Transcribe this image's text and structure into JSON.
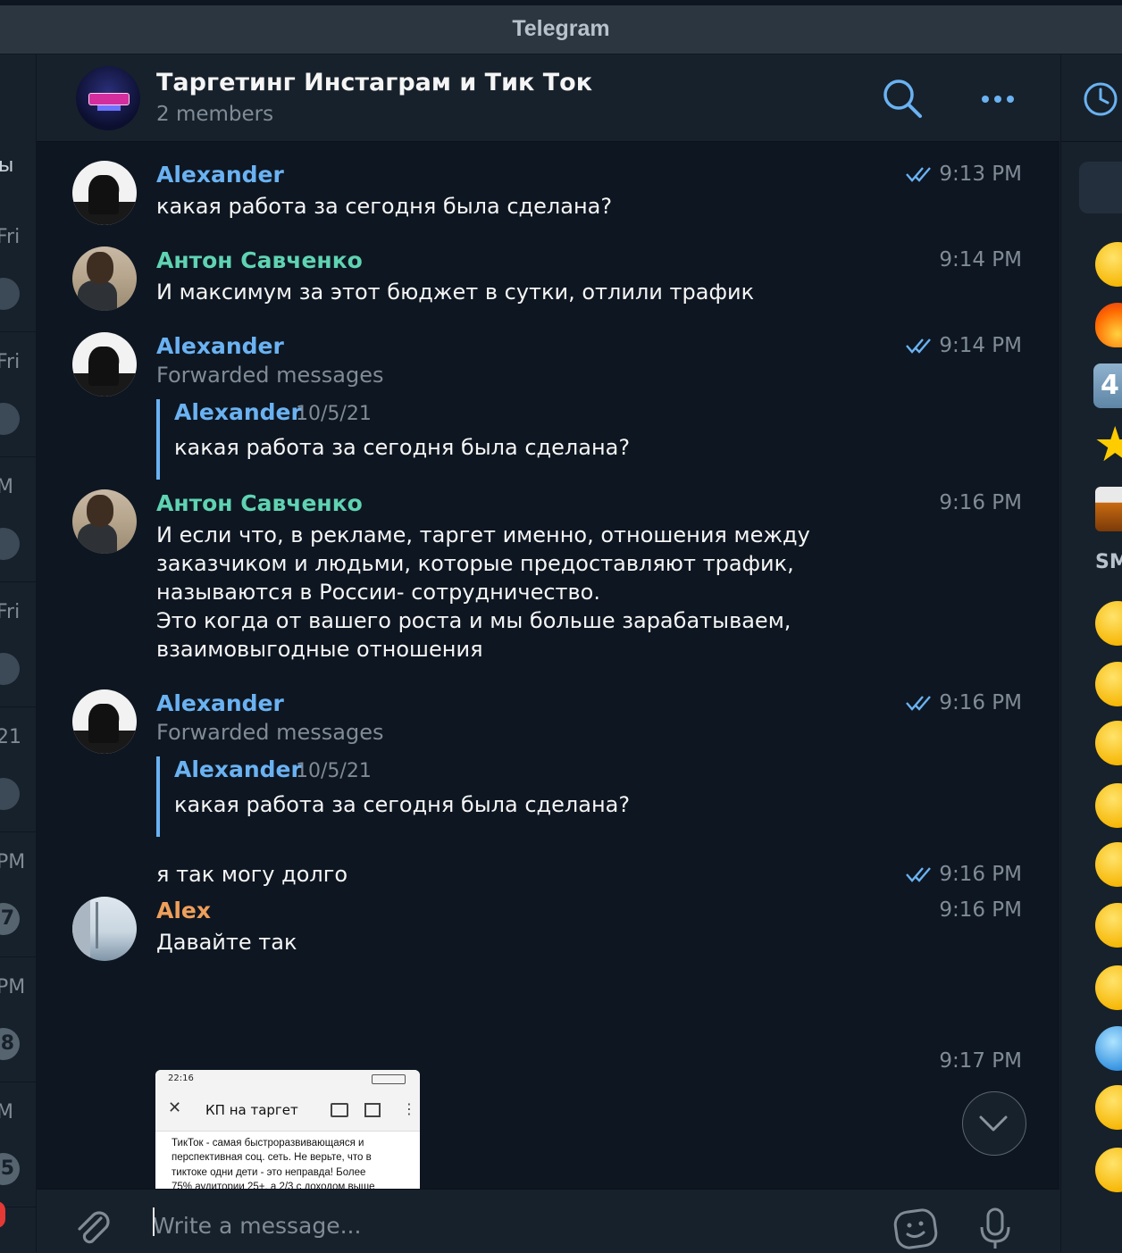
{
  "window": {
    "title": "Telegram"
  },
  "chat_list_partial": {
    "top_fragment": "ы",
    "dates": [
      "Fri",
      "Fri",
      "M",
      "Fri",
      "21",
      "PM",
      "PM",
      "M"
    ],
    "badges": [
      "7",
      "8",
      "5"
    ]
  },
  "header": {
    "title": "Таргетинг Инстаграм и Тик Ток",
    "subtitle": "2 members"
  },
  "messages": [
    {
      "author": "Alexander",
      "time": "9:13 PM",
      "text": "какая работа за сегодня была сделана?"
    },
    {
      "author": "Антон Савченко",
      "time": "9:14 PM",
      "text": "И максимум за этот бюджет в сутки, отлили трафик"
    },
    {
      "author": "Alexander",
      "time": "9:14 PM",
      "label": "Forwarded messages",
      "fwd": {
        "author": "Alexander",
        "date": "10/5/21",
        "text": "какая работа за сегодня была сделана?"
      }
    },
    {
      "author": "Антон Савченко",
      "time": "9:16 PM",
      "text": "И если что, в рекламе, таргет именно, отношения между\nзаказчиком и людьми, которые предоставляют трафик,\nназываются в России- сотрудничество.\nЭто когда от вашего роста и мы больше зарабатываем,\nвзаимовыгодные отношения"
    },
    {
      "author": "Alexander",
      "time": "9:16 PM",
      "label": "Forwarded messages",
      "fwd": {
        "author": "Alexander",
        "date": "10/5/21",
        "text": "какая работа за сегодня была сделана?"
      }
    },
    {
      "time": "9:16 PM",
      "text": "я так могу долго"
    },
    {
      "author": "Alex",
      "time": "9:16 PM",
      "text": "Давайте так"
    },
    {
      "time": "9:17 PM",
      "image": {
        "status_time": "22:16",
        "title": "КП на таргет",
        "body": "ТикТок - самая быстроразвивающаяся и\nперспективная соц. сеть. Не верьте, что в\nтиктоке одни дети - это неправда! Более\n75% аудитории 25+, а 2/3 с доходом выше\nсреднего и средним. Конкуренция в ТикТоке\nзначительно ниже, а результат часто\nвыходит на 40-60% дешевле.\n\nВ наши услуги в период сотрудничества\nвходит:"
      }
    }
  ],
  "composer": {
    "placeholder": "Write a message..."
  },
  "emoji_panel": {
    "number_emoji": "4",
    "section_label": "SM"
  },
  "icons": [
    "search-icon",
    "more-icon",
    "clock-icon",
    "read-check-icon",
    "pin-icon",
    "attach-icon",
    "sticker-icon",
    "microphone-icon",
    "chevron-down-icon"
  ],
  "colors": {
    "accent": "#6ab2f2",
    "name_green": "#5fd3b2",
    "name_orange": "#ee9f5b",
    "background": "#0e1621",
    "panel": "#17212b"
  }
}
